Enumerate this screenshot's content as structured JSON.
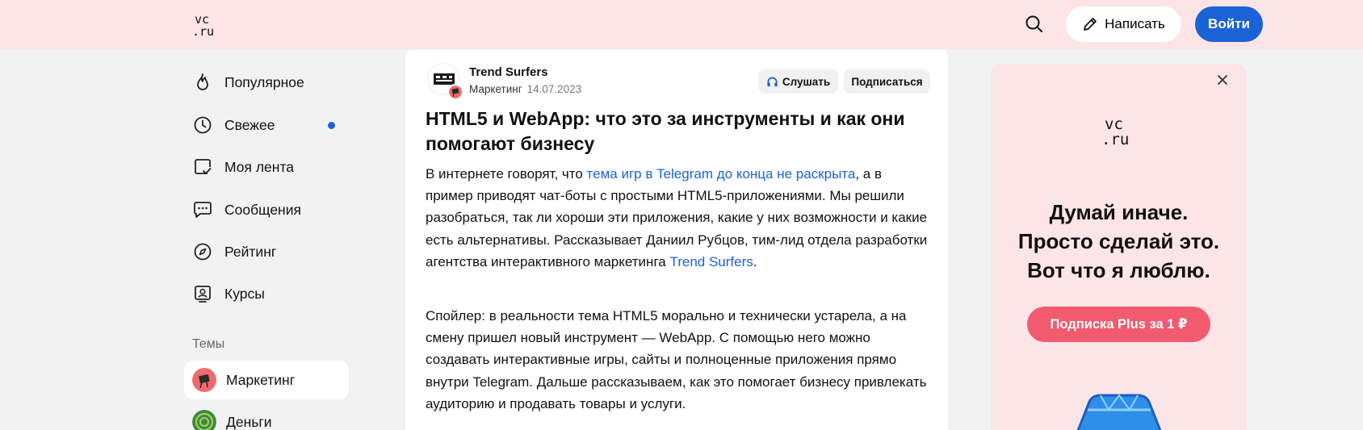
{
  "header": {
    "logo_top": "vc",
    "logo_bottom": ".ru",
    "write_label": "Написать",
    "login_label": "Войти"
  },
  "sidebar": {
    "items": [
      {
        "label": "Популярное",
        "icon": "flame-icon"
      },
      {
        "label": "Свежее",
        "icon": "clock-icon",
        "unread_dot": true
      },
      {
        "label": "Моя лента",
        "icon": "feed-icon"
      },
      {
        "label": "Сообщения",
        "icon": "chat-icon"
      },
      {
        "label": "Рейтинг",
        "icon": "compass-icon"
      },
      {
        "label": "Курсы",
        "icon": "courses-icon"
      }
    ],
    "topics_label": "Темы",
    "topics": [
      {
        "label": "Маркетинг",
        "active": true
      },
      {
        "label": "Деньги",
        "active": false
      }
    ]
  },
  "article": {
    "author": "Trend Surfers",
    "category": "Маркетинг",
    "date": "14.07.2023",
    "listen_label": "Слушать",
    "subscribe_label": "Подписаться",
    "title": "HTML5 и WebApp: что это за инструменты и как они помогают бизнесу",
    "p1_before": "В интернете говорят, что ",
    "p1_link": "тема игр в Telegram до конца не раскрыта",
    "p1_middle": ", а в пример приводят чат-боты с простыми HTML5-приложениями. Мы решили разобраться, так ли хороши эти приложения, какие у них возможности и какие есть альтернативы. Рассказывает Даниил Рубцов, тим-лид отдела разработки агентства интерактивного маркетинга ",
    "p1_link2": "Trend Surfers",
    "p1_after": ".",
    "p2": "Спойлер: в реальности тема HTML5 морально и технически устарела, а на смену пришел новый инструмент — WebApp. С помощью него можно создавать интерактивные игры, сайты и полноценные приложения прямо внутри Telegram. Дальше рассказываем, как это помогает бизнесу привлекать аудиторию и продавать товары и услуги."
  },
  "ad": {
    "logo_top": "vc",
    "logo_bottom": ".ru",
    "line1": "Думай иначе.",
    "line2": "Просто сделай это.",
    "line3": "Вот что я люблю.",
    "cta_label": "Подписка Plus за 1 ₽"
  },
  "colors": {
    "header_bg": "#fde4e7",
    "accent": "#1a62d6",
    "ad_cta": "#f25a70",
    "page_bg": "#f2f2f2"
  }
}
